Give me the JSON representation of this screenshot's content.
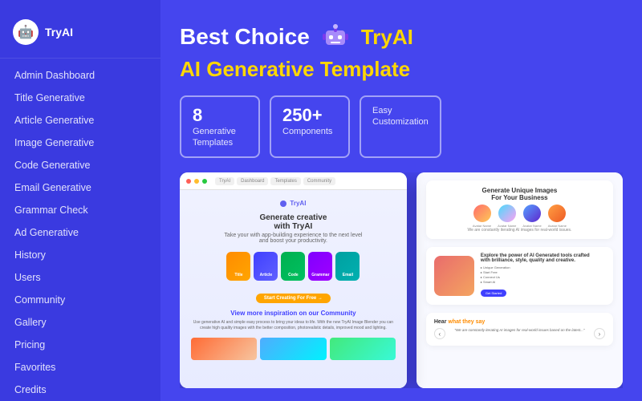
{
  "sidebar": {
    "logo": {
      "icon": "🤖",
      "text": "TryAI"
    },
    "items": [
      {
        "id": "admin-dashboard",
        "label": "Admin Dashboard",
        "active": false
      },
      {
        "id": "title-generative",
        "label": "Title Generative",
        "active": false
      },
      {
        "id": "article-generative",
        "label": "Article Generative",
        "active": false
      },
      {
        "id": "image-generative",
        "label": "Image Generative",
        "active": false
      },
      {
        "id": "code-generative",
        "label": "Code Generative",
        "active": false
      },
      {
        "id": "email-generative",
        "label": "Email Generative",
        "active": false
      },
      {
        "id": "grammar-check",
        "label": "Grammar Check",
        "active": false
      },
      {
        "id": "ad-generative",
        "label": "Ad Generative",
        "active": false
      },
      {
        "id": "history",
        "label": "History",
        "active": false
      },
      {
        "id": "users",
        "label": "Users",
        "active": false
      },
      {
        "id": "community",
        "label": "Community",
        "active": false
      },
      {
        "id": "gallery",
        "label": "Gallery",
        "active": false
      },
      {
        "id": "pricing",
        "label": "Pricing",
        "active": false
      },
      {
        "id": "favorites",
        "label": "Favorites",
        "active": false
      },
      {
        "id": "credits",
        "label": "Credits",
        "active": false
      }
    ]
  },
  "hero": {
    "title1": "Best Choice",
    "robot_emoji": "🤖",
    "brand": "TryAI",
    "title2": "AI Generative Template"
  },
  "badges": [
    {
      "number": "8",
      "label": "Generative\nTemplates"
    },
    {
      "number": "250+",
      "label": "Components"
    },
    {
      "label_only": "Easy\nCustomization"
    }
  ],
  "screenshot_left": {
    "brand_text": "TryAI",
    "hero_text": "Generate creative\nwith TryAI",
    "hero_sub": "Take your with app-building experience to the next level\nand boost your productivity.",
    "cards": [
      {
        "color": "orange",
        "label": "Title"
      },
      {
        "color": "blue",
        "label": "Article"
      },
      {
        "color": "green",
        "label": "Code"
      },
      {
        "color": "purple",
        "label": "Grammar"
      },
      {
        "color": "teal",
        "label": "Email"
      }
    ],
    "cta": "Start Creating For Free →",
    "community_title": "View more inspiration on our Community",
    "community_text": "Use generative AI and simple easy process to bring your ideas\nto life. With the new TryAI Image Blender you can create high\nquality images with the better composition, photorealistic\ndetails, improved mood and lighting."
  },
  "screenshot_right": {
    "section1": {
      "title": "Generate Unique Images\nFor Your Business",
      "avatars": [
        "Avatar 1",
        "Avatar 2",
        "Avatar 3",
        "Avatar 4"
      ],
      "body": "We are constantly iterating AI images for real-world issues."
    },
    "section2": {
      "title": "Explore the power of AI Generated tools crafted\nwith brilliance, style, quality and creative.",
      "list": [
        "▸ Unique Generation",
        "▸ Start Free",
        "▸ Connect Us",
        "▸ Smart AI"
      ],
      "cta": "Get Started"
    },
    "section3": {
      "hear_label": "Hear",
      "what_label": "what they say",
      "testimonial": "\"We are constantly iterating AI images for real-world issues based on the latest...\""
    }
  }
}
